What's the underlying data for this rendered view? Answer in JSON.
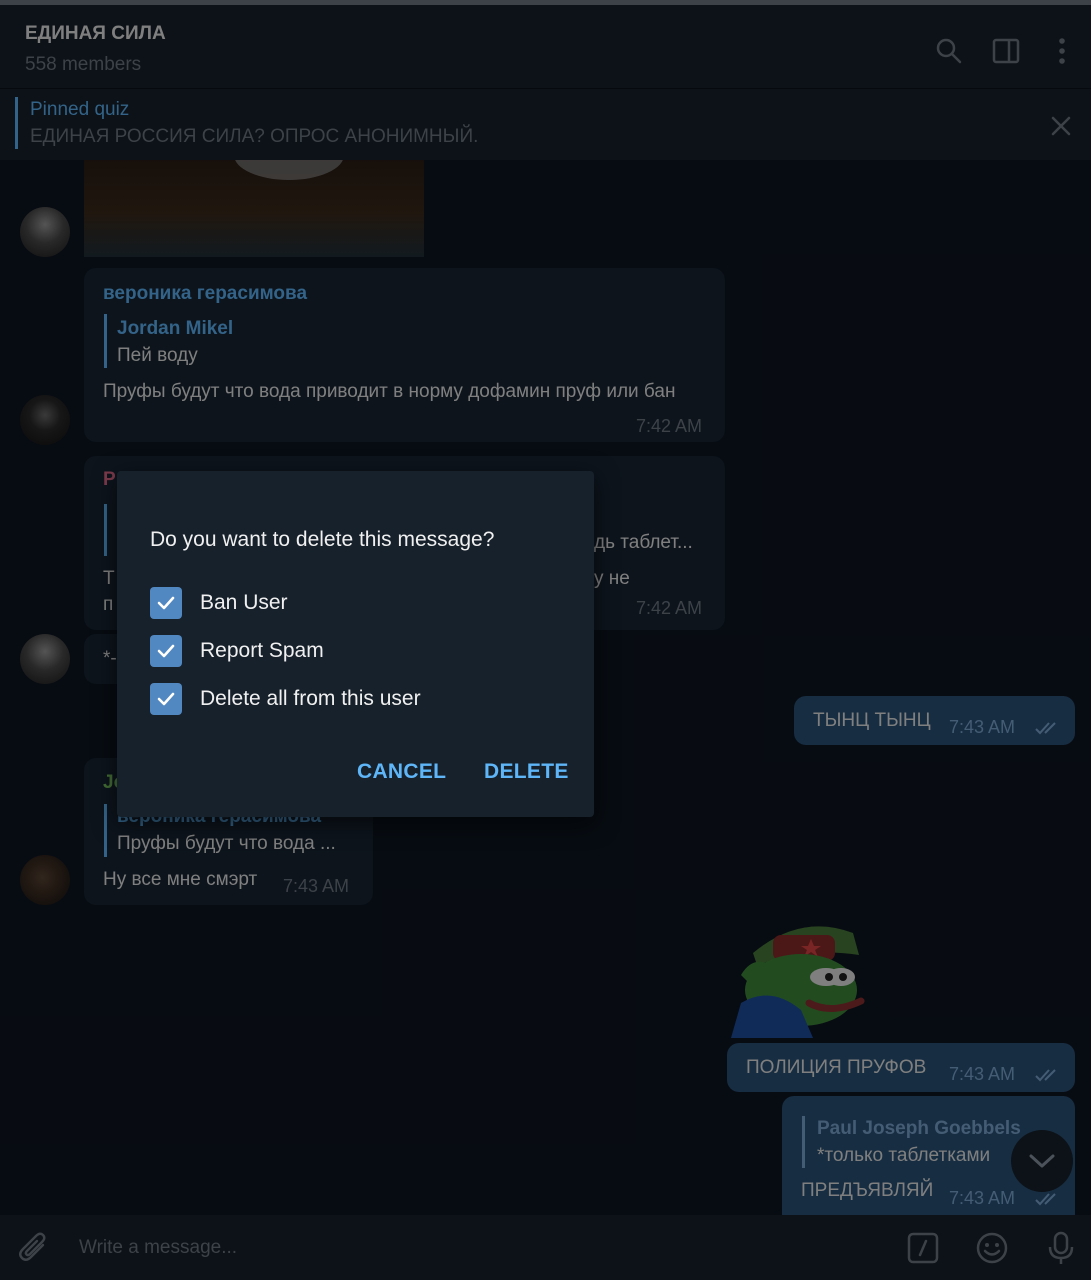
{
  "header": {
    "title": "ЕДИНАЯ СИЛА",
    "subtitle": "558 members",
    "icons": [
      "search-icon",
      "sidebar-toggle-icon",
      "more-vertical-icon"
    ]
  },
  "pinned": {
    "title": "Pinned quiz",
    "text": "ЕДИНАЯ РОССИЯ СИЛА? ОПРОС АНОНИМНЫЙ."
  },
  "messages": {
    "m1": {
      "author": "вероника герасимова",
      "reply_name": "Jordan Mikel",
      "reply_text": "Пей воду",
      "text": "Пруфы будут что вода приводит в норму дофамин пруф или бан",
      "time": "7:42 AM"
    },
    "m2": {
      "author_fragment": "P",
      "reply_fragment": "дь таблет...",
      "line1_left": "Т",
      "line1_right": "у не",
      "line2_left": "п",
      "time": "7:42 AM"
    },
    "m3": {
      "fragment": "*-"
    },
    "m4": {
      "text": "ТЫНЦ ТЫНЦ",
      "time": "7:43 AM"
    },
    "m5": {
      "author_fragment": "Jo",
      "reply_name": "вероника герасимова",
      "reply_text": "Пруфы будут что вода ...",
      "text": "Ну все мне смэрт",
      "time": "7:43 AM"
    },
    "m6": {
      "text": "ПОЛИЦИЯ ПРУФОВ",
      "time": "7:43 AM"
    },
    "m7": {
      "reply_name": "Paul Joseph Goebbels",
      "reply_text": "*только таблетками",
      "text": "ПРЕДЪЯВЛЯЙ",
      "time": "7:43 AM"
    }
  },
  "dialog": {
    "question": "Do you want to delete this message?",
    "options": [
      {
        "label": "Ban User",
        "checked": true
      },
      {
        "label": "Report Spam",
        "checked": true
      },
      {
        "label": "Delete all from this user",
        "checked": true
      }
    ],
    "cancel": "CANCEL",
    "delete": "DELETE"
  },
  "composer": {
    "placeholder": "Write a message...",
    "icons": [
      "attach-icon",
      "bot-command-icon",
      "emoji-icon",
      "microphone-icon"
    ]
  },
  "colors": {
    "accent": "#5eb5f7",
    "checkbox": "#5288c1",
    "header_bg": "#17212b",
    "chat_bg": "#0e1621",
    "incoming_bubble": "#182533",
    "outgoing_bubble": "#2b5278",
    "author_pink": "#e46a8a",
    "author_green": "#7bc862"
  }
}
